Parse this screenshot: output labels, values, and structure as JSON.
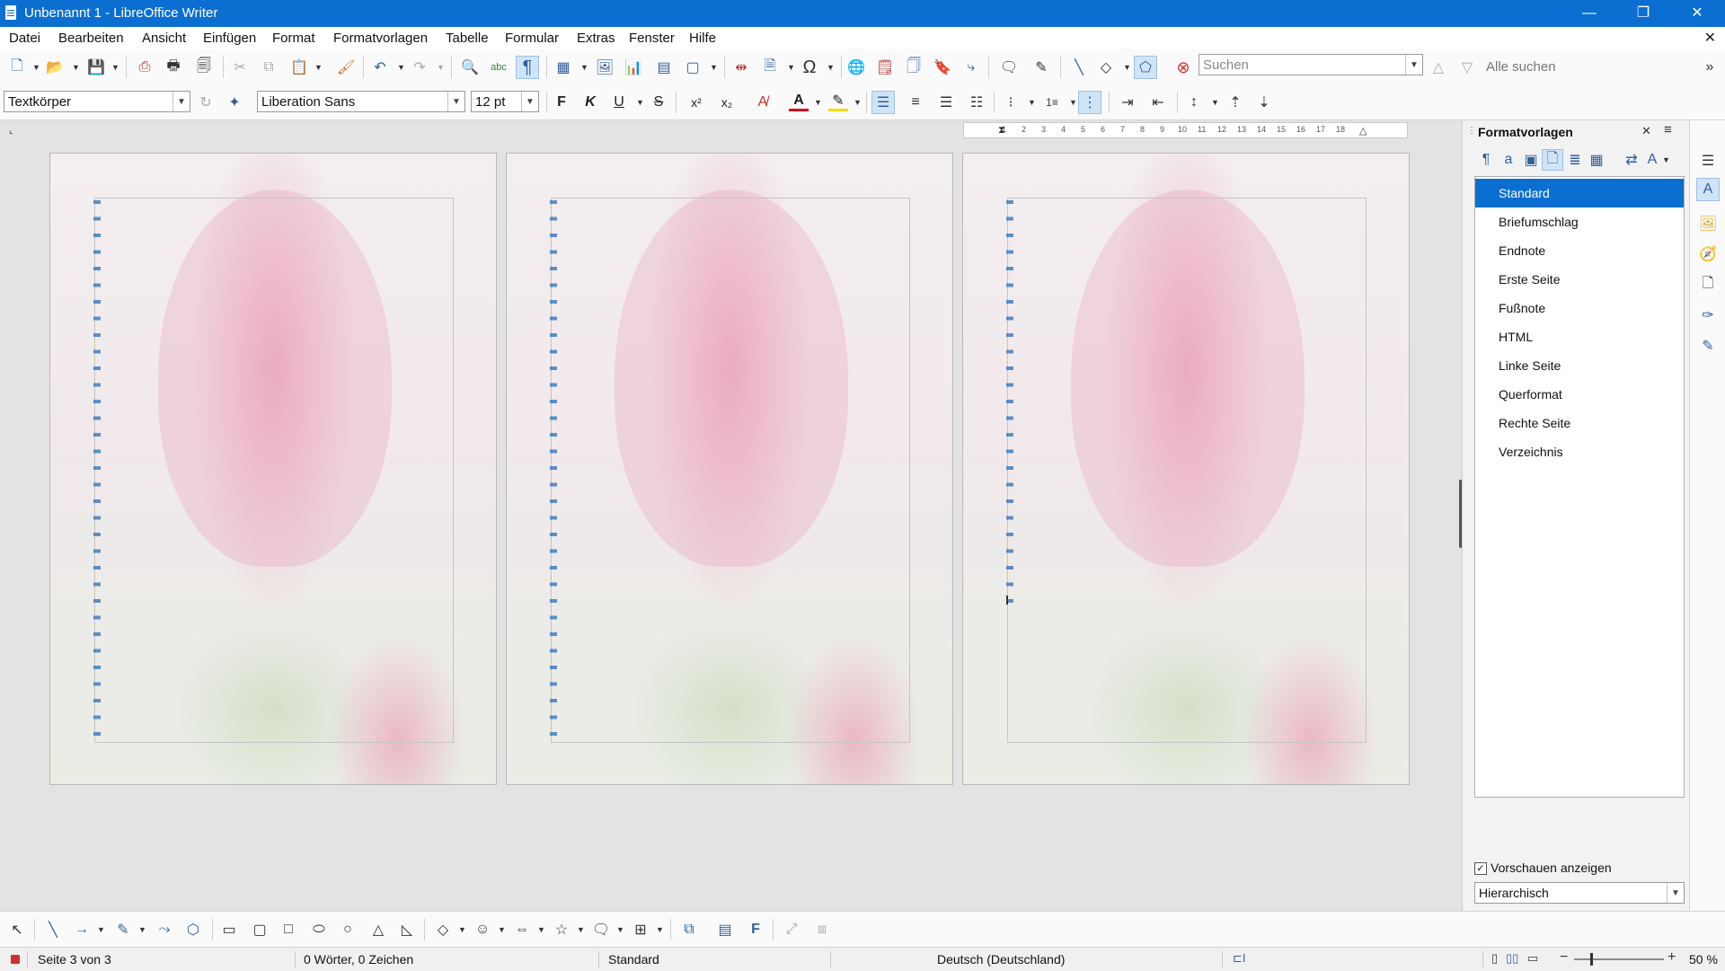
{
  "window": {
    "title": "Unbenannt 1 - LibreOffice Writer",
    "controls": {
      "minimize": "—",
      "maximize": "❐",
      "close": "✕"
    }
  },
  "menu": {
    "items": [
      "Datei",
      "Bearbeiten",
      "Ansicht",
      "Einfügen",
      "Format",
      "Formatvorlagen",
      "Tabelle",
      "Formular",
      "Extras",
      "Fenster",
      "Hilfe"
    ],
    "close_doc": "✕"
  },
  "toolbar": {
    "search_placeholder": "Suchen",
    "find_all": "Alle suchen",
    "paragraph_style": "Textkörper",
    "font_name": "Liberation Sans",
    "font_size": "12 pt",
    "bold": "F",
    "italic": "K",
    "underline": "U",
    "strike": "S",
    "superscript": "x²",
    "subscript": "x₂"
  },
  "ruler": {
    "ticks": [
      "1",
      "2",
      "3",
      "4",
      "5",
      "6",
      "7",
      "8",
      "9",
      "10",
      "11",
      "12",
      "13",
      "14",
      "15",
      "16",
      "17",
      "18"
    ]
  },
  "document": {
    "page_count": 3,
    "background": "tulip"
  },
  "sidebar": {
    "title": "Formatvorlagen",
    "close": "✕",
    "menu": "≡",
    "styles": [
      "Standard",
      "Briefumschlag",
      "Endnote",
      "Erste Seite",
      "Fußnote",
      "HTML",
      "Linke Seite",
      "Querformat",
      "Rechte Seite",
      "Verzeichnis"
    ],
    "selected_style": "Standard",
    "show_previews": "Vorschauen anzeigen",
    "show_previews_checked": true,
    "filter": "Hierarchisch"
  },
  "statusbar": {
    "page": "Seite 3 von 3",
    "words": "0 Wörter, 0 Zeichen",
    "page_style": "Standard",
    "language": "Deutsch (Deutschland)",
    "zoom": "50 %"
  },
  "colors": {
    "titlebar": "#0a6fd0",
    "selection": "#0a6fd0",
    "accent_icon": "#2f5f9e"
  }
}
